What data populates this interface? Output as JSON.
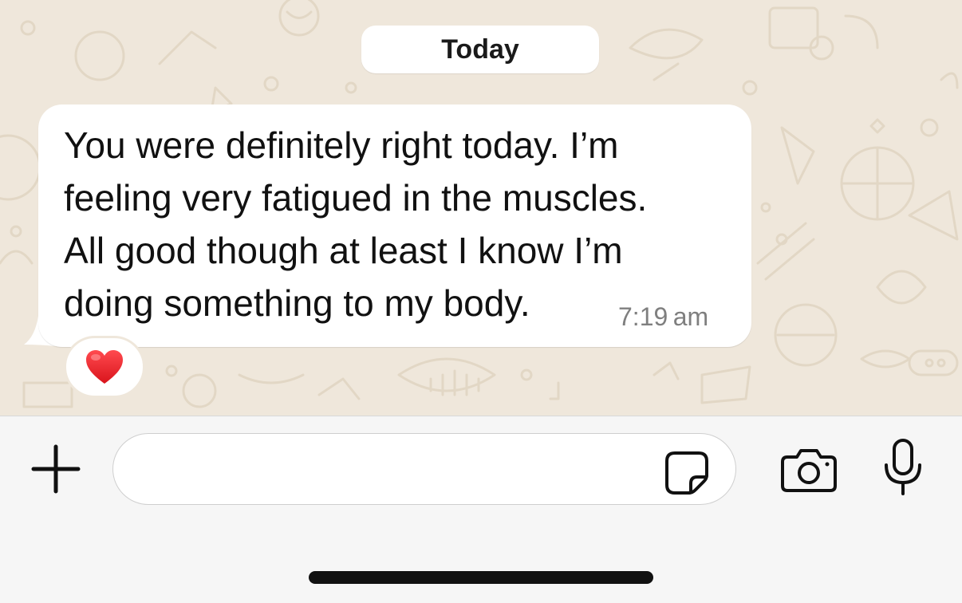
{
  "conversation": {
    "date_separator": "Today",
    "message": {
      "lines": [
        "You were definitely right today. I’m",
        "feeling very fatigued in the muscles.",
        "All good though at least I know I’m",
        "doing something to my body."
      ],
      "time": "7:19 am",
      "reaction": "❤️"
    }
  },
  "composer": {
    "message_value": "",
    "icons": {
      "attach": "plus-icon",
      "sticker": "sticker-icon",
      "camera": "camera-icon",
      "voice": "microphone-icon"
    }
  },
  "colors": {
    "wallpaper": "#efe7db",
    "bubble": "#ffffff",
    "reaction_heart": "#e8262b",
    "home_indicator": "#111111"
  }
}
